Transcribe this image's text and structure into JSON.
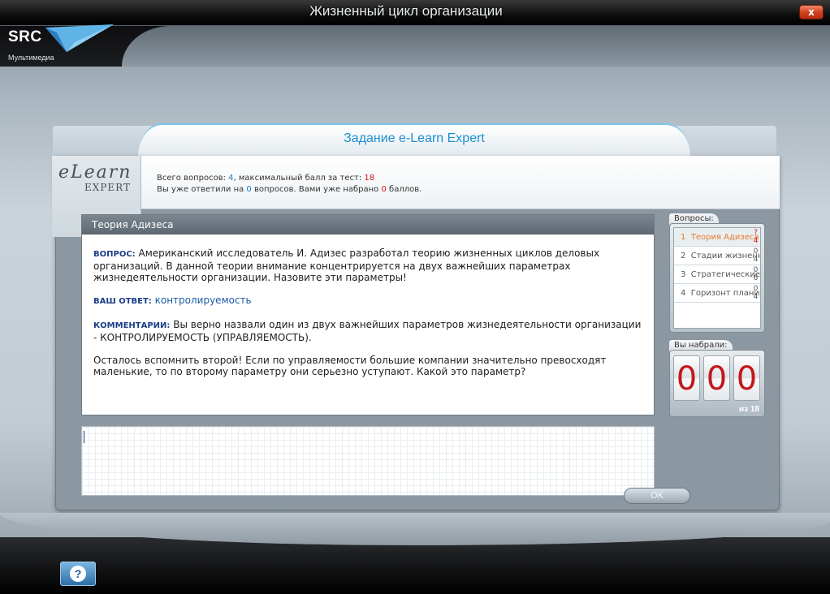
{
  "window": {
    "title": "Жизненный цикл организации",
    "close_label": "x"
  },
  "logo": {
    "brand": "SRC",
    "sub": "Мультимедиа"
  },
  "task": {
    "title": "Задание e-Learn Expert",
    "logo_top": "eLearn",
    "logo_bottom": "EXPERT"
  },
  "stats": {
    "line1_prefix": "Всего вопросов: ",
    "total_questions": "4",
    "line1_middle": ", максимальный балл за тест: ",
    "max_score": "18",
    "line2_prefix": "Вы уже ответили на ",
    "answered": "0",
    "line2_middle": " вопросов. Вами уже набрано ",
    "scored": "0",
    "line2_suffix": " баллов."
  },
  "question": {
    "header": "Теория Адизеса",
    "q_label": "ВОПРОС:",
    "q_text": " Американский исследователь И. Адизес разработал теорию жизненных циклов деловых организаций. В данной теории внимание концентрируется на двух важнейших параметрах жизнедеятельности организации. Назовите эти параметры!",
    "a_label": "ВАШ ОТВЕТ:",
    "a_text": " контролируемость",
    "c_label": "КОММЕНТАРИИ:",
    "c_text": " Вы верно назвали один из двух важнейших параметров жизнедеятельности организации - КОНТРОЛИРУЕМОСТЬ (УПРАВЛЯЕМОСТЬ).",
    "followup": "Осталось вспомнить второй! Если по управляемости большие компании значительно превосходят маленькие, то по второму параметру они серьезно уступают. Какой это параметр?"
  },
  "answer": {
    "value": "",
    "ok_label": "OK"
  },
  "questions_panel": {
    "label": "Вопросы:",
    "items": [
      {
        "num": "1",
        "title": "Теория Адизеса",
        "score_top": "?",
        "score_bottom": "4"
      },
      {
        "num": "2",
        "title": "Стадии жизненного цикла",
        "score_top": "0",
        "score_bottom": "4"
      },
      {
        "num": "3",
        "title": "Стратегические",
        "score_top": "0",
        "score_bottom": "6"
      },
      {
        "num": "4",
        "title": "Горизонт планирования",
        "score_top": "0",
        "score_bottom": "4"
      }
    ]
  },
  "score_panel": {
    "label": "Вы набрали:",
    "digits": [
      "0",
      "0",
      "0"
    ],
    "of_text": "из 18"
  },
  "help": {
    "label": "?"
  },
  "colors": {
    "accent": "#1d8fd0",
    "digit_red": "#c4161c",
    "active_item": "#e47b2c"
  }
}
